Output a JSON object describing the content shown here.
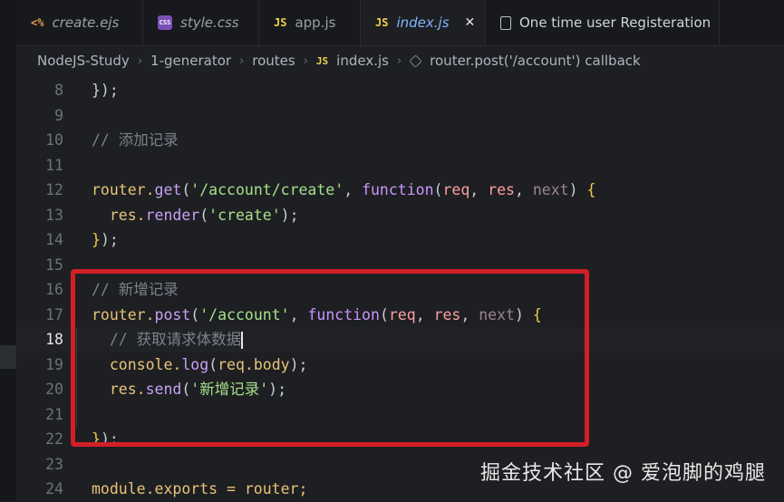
{
  "tabs": [
    {
      "icon": "<%",
      "label": "create.ejs"
    },
    {
      "icon": "CSS",
      "label": "style.css"
    },
    {
      "icon": "JS",
      "label": "app.js"
    },
    {
      "icon": "JS",
      "label": "index.js",
      "close": "✕"
    },
    {
      "label": "One time user Registeration"
    }
  ],
  "breadcrumb": {
    "items": [
      "NodeJS-Study",
      "1-generator",
      "routes"
    ],
    "file_icon": "JS",
    "file": "index.js",
    "symbol": "router.post('/account') callback",
    "separator": "›"
  },
  "editor": {
    "current_line": "18",
    "line_numbers": [
      "8",
      "9",
      "10",
      "11",
      "12",
      "13",
      "14",
      "15",
      "16",
      "17",
      "18",
      "19",
      "20",
      "21",
      "22",
      "23",
      "24"
    ],
    "code": {
      "l8": [
        [
          "});",
          "pun"
        ]
      ],
      "l10": [
        [
          "// 添加记录",
          "com"
        ]
      ],
      "l12": [
        [
          "router.",
          "id"
        ],
        [
          "get",
          "fn"
        ],
        [
          "(",
          "pun"
        ],
        [
          "'/account/create'",
          "str"
        ],
        [
          ", ",
          "pun"
        ],
        [
          "function",
          "kw"
        ],
        [
          "(",
          "pun"
        ],
        [
          "req",
          "param"
        ],
        [
          ", ",
          "pun"
        ],
        [
          "res",
          "param"
        ],
        [
          ", ",
          "pun"
        ],
        [
          "next",
          "next"
        ],
        [
          ") ",
          "pun"
        ],
        [
          "{",
          "br1"
        ]
      ],
      "l13": [
        [
          "  res.",
          "id"
        ],
        [
          "render",
          "fn"
        ],
        [
          "(",
          "pun"
        ],
        [
          "'create'",
          "str"
        ],
        [
          ");",
          "pun"
        ]
      ],
      "l14": [
        [
          "}",
          "br1"
        ],
        [
          ");",
          "pun"
        ]
      ],
      "l16": [
        [
          "// 新增记录",
          "com"
        ]
      ],
      "l17": [
        [
          "router.",
          "id"
        ],
        [
          "post",
          "fn"
        ],
        [
          "(",
          "pun"
        ],
        [
          "'/account'",
          "str"
        ],
        [
          ", ",
          "pun"
        ],
        [
          "function",
          "kw"
        ],
        [
          "(",
          "pun"
        ],
        [
          "req",
          "param"
        ],
        [
          ", ",
          "pun"
        ],
        [
          "res",
          "param"
        ],
        [
          ", ",
          "pun"
        ],
        [
          "next",
          "next"
        ],
        [
          ") ",
          "pun"
        ],
        [
          "{",
          "br1"
        ]
      ],
      "l18": [
        [
          "  // 获取请求体数据",
          "com"
        ]
      ],
      "l19": [
        [
          "  console.",
          "id"
        ],
        [
          "log",
          "fn"
        ],
        [
          "(",
          "pun"
        ],
        [
          "req.body",
          "id"
        ],
        [
          ");",
          "pun"
        ]
      ],
      "l20": [
        [
          "  res.",
          "id"
        ],
        [
          "send",
          "fn"
        ],
        [
          "(",
          "pun"
        ],
        [
          "'新增记录'",
          "str"
        ],
        [
          ");",
          "pun"
        ]
      ],
      "l22": [
        [
          "}",
          "br1"
        ],
        [
          ");",
          "pun"
        ]
      ],
      "l24": [
        [
          "module.exports = router;",
          "id"
        ]
      ]
    }
  },
  "watermark": "掘金技术社区 @ 爱泡脚的鸡腿",
  "colors": {
    "highlight": "#d21f26",
    "tab_active": "#7eb6ff",
    "js_icon": "#f1d34b"
  }
}
